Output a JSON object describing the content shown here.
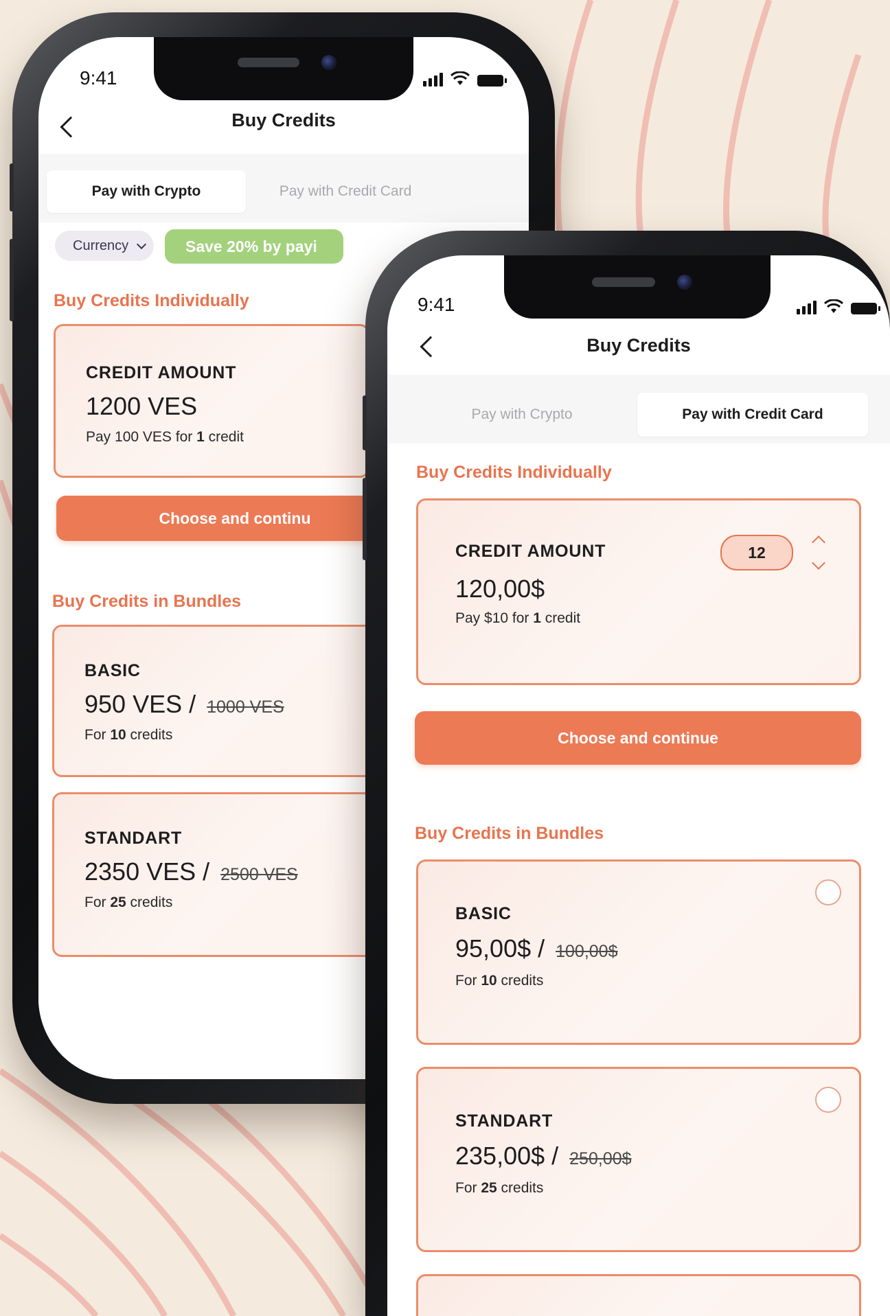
{
  "colors": {
    "background": "#f4ebde",
    "accent": "#ec7a55",
    "section_title": "#e8744f",
    "card_border": "#eb8c69",
    "save_chip": "#a3d17c",
    "currency_chip": "#eeeaf2"
  },
  "back_phone": {
    "status": {
      "time": "9:41",
      "icons": [
        "signal-icon",
        "wifi-icon",
        "battery-icon"
      ]
    },
    "nav": {
      "title": "Buy Credits",
      "back_icon": "chevron-left-icon"
    },
    "tabs": [
      {
        "label": "Pay with Crypto",
        "active": true
      },
      {
        "label": "Pay with Credit Card",
        "active": false
      }
    ],
    "currency_chip": {
      "label": "Currency",
      "icon": "chevron-down-icon"
    },
    "save_banner": "Save 20% by payi",
    "individual": {
      "section_title": "Buy Credits Individually",
      "card": {
        "label": "CREDIT AMOUNT",
        "price": "1200 VES",
        "sub_prefix": "Pay 100 VES for ",
        "sub_bold": "1",
        "sub_suffix": " credit"
      },
      "button": "Choose and continu"
    },
    "bundles": {
      "section_title": "Buy Credits in Bundles",
      "items": [
        {
          "name": "BASIC",
          "price": "950 VES",
          "separator": "/",
          "old_price": "1000 VES",
          "sub_prefix": "For ",
          "sub_bold": "10",
          "sub_suffix": " credits"
        },
        {
          "name": "STANDART",
          "price": "2350 VES",
          "separator": "/",
          "old_price": "2500 VES",
          "sub_prefix": "For ",
          "sub_bold": "25",
          "sub_suffix": " credits"
        }
      ]
    }
  },
  "front_phone": {
    "status": {
      "time": "9:41",
      "icons": [
        "signal-icon",
        "wifi-icon",
        "battery-icon"
      ]
    },
    "nav": {
      "title": "Buy Credits",
      "back_icon": "chevron-left-icon"
    },
    "tabs": [
      {
        "label": "Pay with Crypto",
        "active": false
      },
      {
        "label": "Pay with Credit Card",
        "active": true
      }
    ],
    "individual": {
      "section_title": "Buy Credits Individually",
      "card": {
        "label": "CREDIT AMOUNT",
        "quantity": "12",
        "stepper_icons": [
          "chevron-up-icon",
          "chevron-down-icon"
        ],
        "price": "120,00$",
        "sub_prefix": "Pay $10 for ",
        "sub_bold": "1",
        "sub_suffix": " credit"
      },
      "button": "Choose and continue"
    },
    "bundles": {
      "section_title": "Buy Credits in Bundles",
      "items": [
        {
          "name": "BASIC",
          "price": "95,00$",
          "separator": "/",
          "old_price": "100,00$",
          "sub_prefix": "For ",
          "sub_bold": "10",
          "sub_suffix": " credits",
          "selected": false
        },
        {
          "name": "STANDART",
          "price": "235,00$",
          "separator": "/",
          "old_price": "250,00$",
          "sub_prefix": "For ",
          "sub_bold": "25",
          "sub_suffix": " credits",
          "selected": false
        }
      ]
    }
  }
}
